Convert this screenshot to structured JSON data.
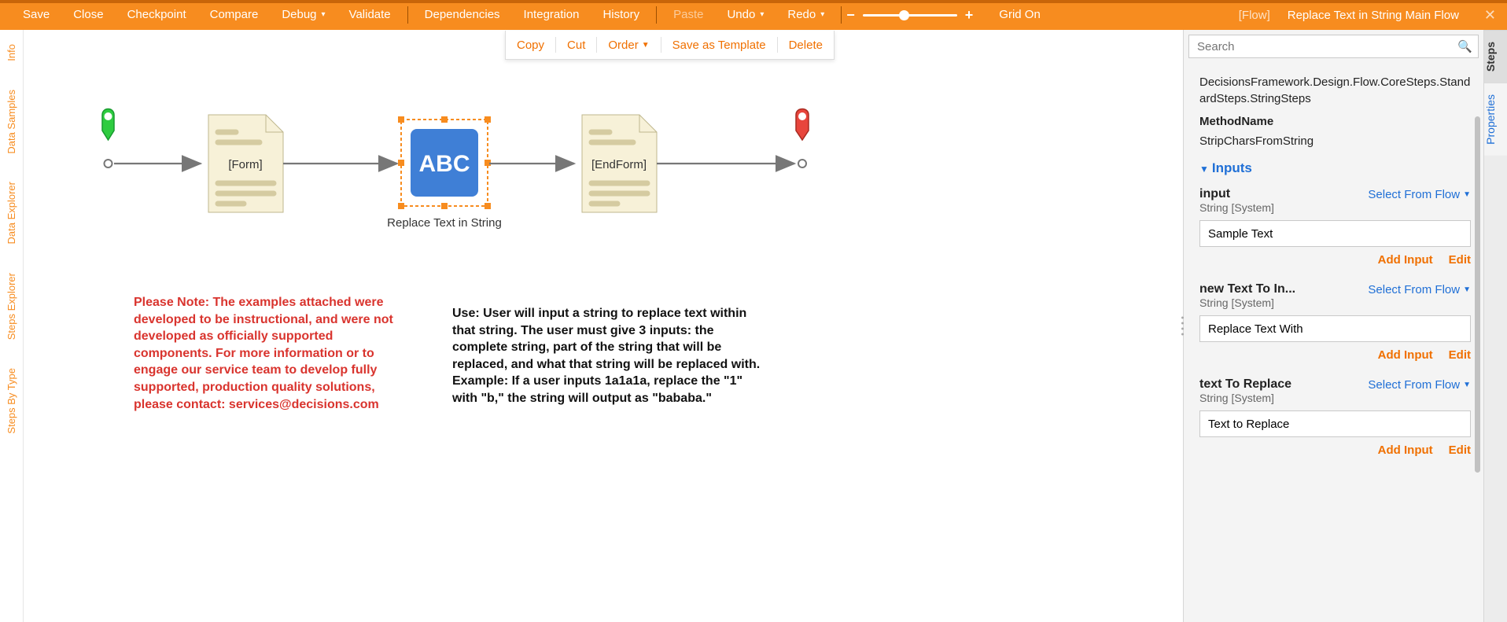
{
  "toolbar": {
    "save": "Save",
    "close": "Close",
    "checkpoint": "Checkpoint",
    "compare": "Compare",
    "debug": "Debug",
    "validate": "Validate",
    "dependencies": "Dependencies",
    "integration": "Integration",
    "history": "History",
    "paste": "Paste",
    "undo": "Undo",
    "redo": "Redo",
    "grid": "Grid On",
    "flow_tag": "[Flow]",
    "flow_title": "Replace Text in String Main Flow"
  },
  "context_menu": {
    "copy": "Copy",
    "cut": "Cut",
    "order": "Order",
    "save_template": "Save as Template",
    "delete": "Delete"
  },
  "left_tabs": [
    "Info",
    "Data Samples",
    "Data Explorer",
    "Steps Explorer",
    "Steps By Type"
  ],
  "right_tabs": {
    "steps": "Steps",
    "properties": "Properties"
  },
  "canvas": {
    "form_label": "[Form]",
    "selected_node_label": "Replace Text in String",
    "selected_node_icon_text": "ABC",
    "endform_label": "[EndForm]",
    "note_red": "Please Note: The examples attached were developed to be instructional, and were not developed as officially supported components.  For more information or to engage our service team to develop fully supported, production quality solutions, please contact: services@decisions.com",
    "note_black": "Use: User will input a string to replace text within that string. The user must give 3 inputs: the complete string, part of the string that will be replaced, and what that string will be replaced with. Example: If a user inputs 1a1a1a, replace the \"1\" with \"b,\" the string will output as \"bababa.\""
  },
  "panel": {
    "search_placeholder": "Search",
    "namespace": "DecisionsFramework.Design.Flow.CoreSteps.StandardSteps.StringSteps",
    "method_label": "MethodName",
    "method_value": "StripCharsFromString",
    "section_inputs": "Inputs",
    "select_from_flow": "Select From Flow",
    "string_system": "String [System]",
    "add_input": "Add Input",
    "edit": "Edit",
    "inputs": [
      {
        "name": "input",
        "value": "Sample Text"
      },
      {
        "name": "new Text To In...",
        "value": "Replace Text With"
      },
      {
        "name": "text To Replace",
        "value": "Text to Replace"
      }
    ]
  }
}
